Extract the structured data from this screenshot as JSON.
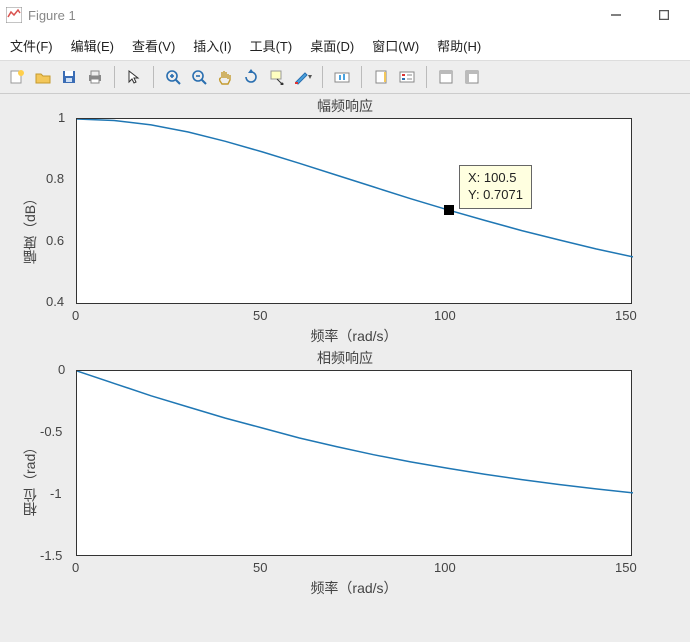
{
  "window": {
    "title": "Figure 1"
  },
  "menu": {
    "file": "文件(F)",
    "edit": "编辑(E)",
    "view": "查看(V)",
    "insert": "插入(I)",
    "tools": "工具(T)",
    "desktop": "桌面(D)",
    "window": "窗口(W)",
    "help": "帮助(H)"
  },
  "chart1": {
    "title": "幅频响应",
    "xlabel": "频率（rad/s）",
    "ylabel": "幅度（dB）",
    "xticks": {
      "t0": "0",
      "t1": "50",
      "t2": "100",
      "t3": "150"
    },
    "yticks": {
      "t0": "0.4",
      "t1": "0.6",
      "t2": "0.8",
      "t3": "1"
    },
    "datatip": {
      "line1": "X: 100.5",
      "line2": "Y: 0.7071"
    }
  },
  "chart2": {
    "title": "相频响应",
    "xlabel": "频率（rad/s）",
    "ylabel": "相位（rad）",
    "xticks": {
      "t0": "0",
      "t1": "50",
      "t2": "100",
      "t3": "150"
    },
    "yticks": {
      "t0": "-1.5",
      "t1": "-1",
      "t2": "-0.5",
      "t3": "0"
    }
  },
  "colors": {
    "line": "#1f77b4"
  },
  "chart_data": [
    {
      "type": "line",
      "title": "幅频响应",
      "xlabel": "频率（rad/s）",
      "ylabel": "幅度（dB）",
      "xlim": [
        0,
        150
      ],
      "ylim": [
        0.4,
        1.0
      ],
      "x": [
        0,
        10,
        20,
        30,
        40,
        50,
        60,
        70,
        80,
        90,
        100,
        110,
        120,
        130,
        140,
        150
      ],
      "y": [
        1.0,
        0.995,
        0.981,
        0.958,
        0.928,
        0.894,
        0.857,
        0.819,
        0.781,
        0.743,
        0.707,
        0.673,
        0.64,
        0.61,
        0.581,
        0.555
      ],
      "annotation": {
        "x": 100.5,
        "y": 0.7071
      }
    },
    {
      "type": "line",
      "title": "相频响应",
      "xlabel": "频率（rad/s）",
      "ylabel": "相位（rad）",
      "xlim": [
        0,
        150
      ],
      "ylim": [
        -1.5,
        0
      ],
      "x": [
        0,
        10,
        20,
        30,
        40,
        50,
        60,
        70,
        80,
        90,
        100,
        110,
        120,
        130,
        140,
        150
      ],
      "y": [
        0.0,
        -0.1,
        -0.2,
        -0.29,
        -0.38,
        -0.46,
        -0.54,
        -0.61,
        -0.675,
        -0.733,
        -0.785,
        -0.833,
        -0.876,
        -0.915,
        -0.951,
        -0.983
      ]
    }
  ]
}
